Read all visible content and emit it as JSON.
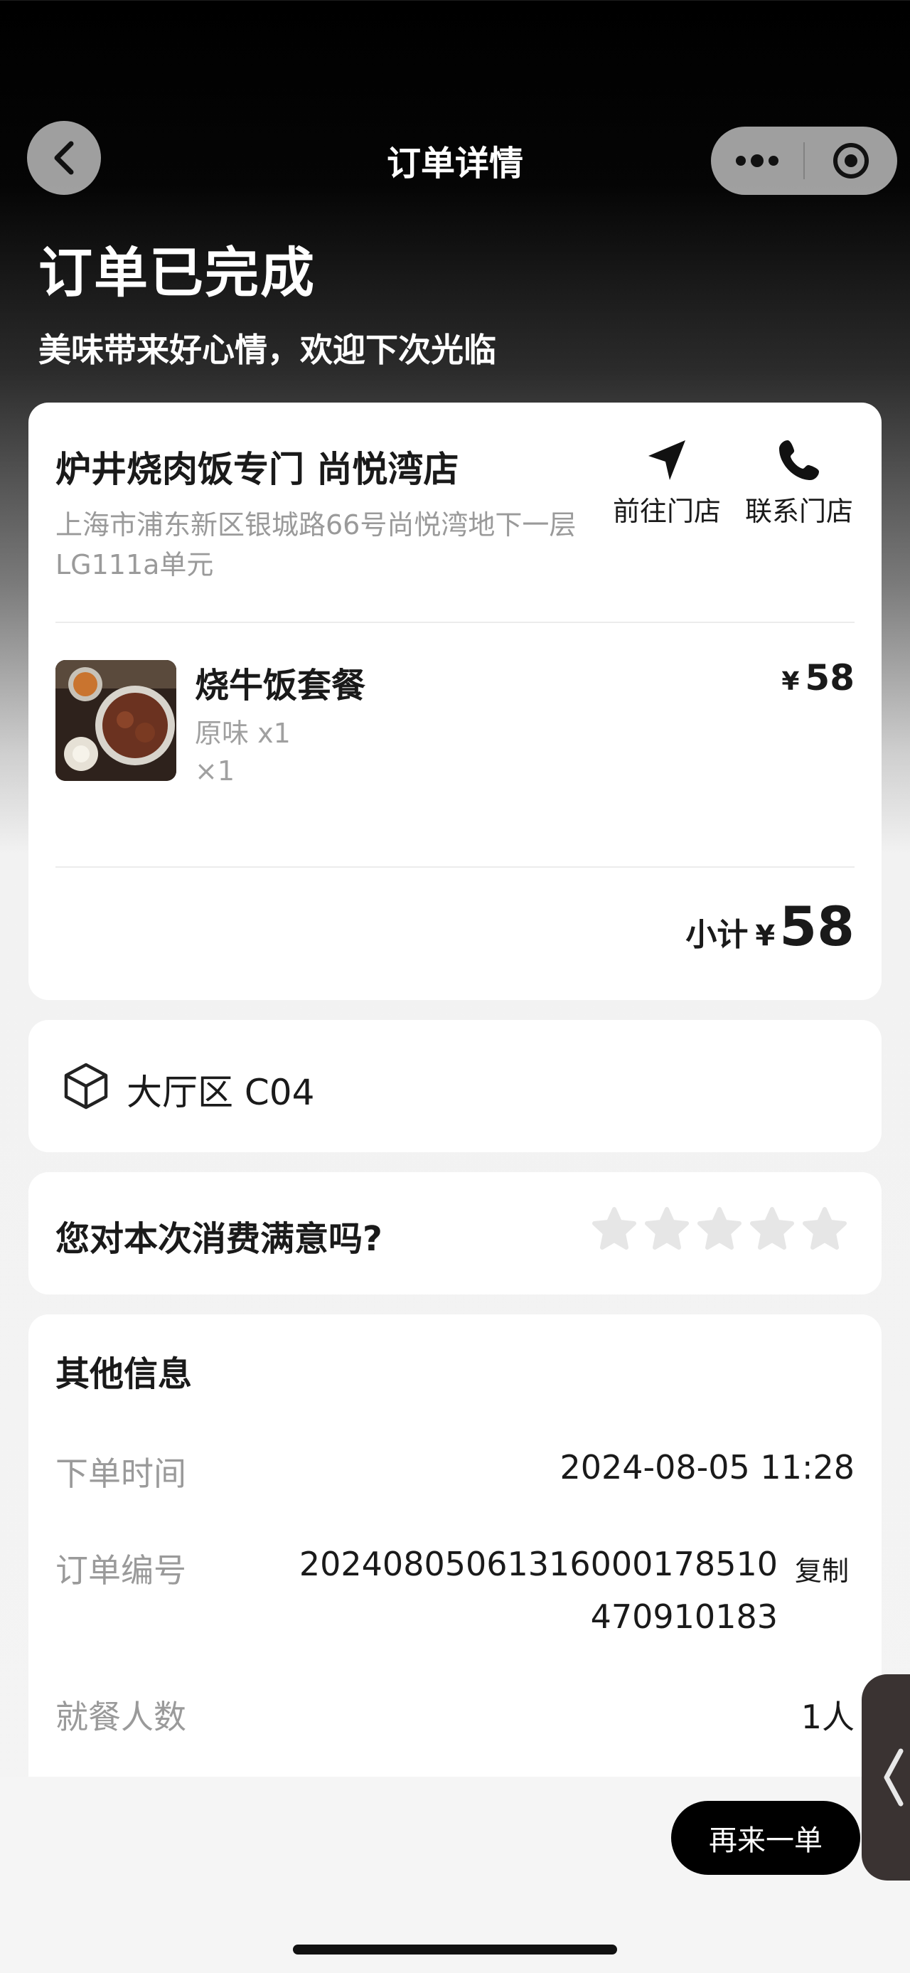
{
  "nav": {
    "title": "订单详情",
    "back_icon": "chevron-left-icon",
    "more_icon": "more-dots-icon",
    "close_icon": "target-circle-icon"
  },
  "status": {
    "title": "订单已完成",
    "subtitle": "美味带来好心情，欢迎下次光临"
  },
  "store": {
    "name": "炉井烧肉饭专门 尚悦湾店",
    "address": "上海市浦东新区银城路66号尚悦湾地下一层LG111a单元",
    "go_label": "前往门店",
    "contact_label": "联系门店",
    "go_icon": "navigation-arrow-icon",
    "contact_icon": "phone-icon"
  },
  "order_item": {
    "name": "烧牛饭套餐",
    "spec": "原味 x1",
    "qty": "×1",
    "currency": "¥",
    "price": "58"
  },
  "subtotal": {
    "label": "小计",
    "currency": "¥",
    "amount": "58"
  },
  "table": {
    "icon": "cube-icon",
    "text": "大厅区 C04"
  },
  "rating": {
    "question": "您对本次消费满意吗?",
    "stars_max": 5,
    "stars_value": 0,
    "star_color_empty": "#e6e6e6"
  },
  "info": {
    "title": "其他信息",
    "order_time_label": "下单时间",
    "order_time_value": "2024-08-05 11:28",
    "order_no_label": "订单编号",
    "order_no_line1": "20240805061316000178510",
    "order_no_line2": "470910183",
    "copy_label": "复制",
    "diners_label": "就餐人数",
    "diners_value": "1人"
  },
  "footer": {
    "reorder_label": "再来一单",
    "side_tab_icon": "chevron-left-icon"
  }
}
